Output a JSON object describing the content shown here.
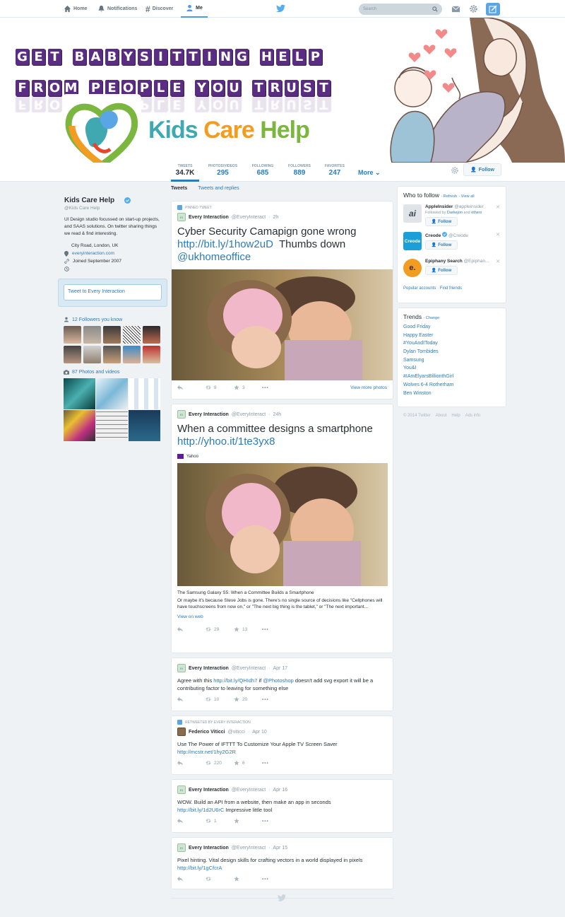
{
  "nav": {
    "home": "Home",
    "notifications": "Notifications",
    "discover": "Discover",
    "me": "Me",
    "search_placeholder": "Search"
  },
  "banner": {
    "line1": "GET BABYSITTING HELP",
    "line2": "FROM PEOPLE YOU TRUST",
    "brand_part1": "Kids ",
    "brand_part2": "Care ",
    "brand_part3": "Help"
  },
  "stats": [
    {
      "label": "TWEETS",
      "value": "34.7K"
    },
    {
      "label": "PHOTOS/VIDEOS",
      "value": "295"
    },
    {
      "label": "FOLLOWING",
      "value": "685"
    },
    {
      "label": "FOLLOWERS",
      "value": "889"
    },
    {
      "label": "FAVORITES",
      "value": "247"
    }
  ],
  "more_label": "More",
  "follow_label": "Follow",
  "profile": {
    "name": "Kids Care Help",
    "handle": "@Kids Care Help",
    "bio": "UI Design studio focussed on start-up projects, and SAAS solutions. On twitter sharing things we read & find interesting.",
    "location": "City Road, London, UK",
    "website": "everyinteraction.com",
    "joined": "Joined September 2007",
    "tweet_to": "Tweet to Every Interaction",
    "followers_known": "12 Followers you know",
    "photos_videos": "87 Photos and videos"
  },
  "tabs": {
    "tweets": "Tweets",
    "replies": "Tweets and replies"
  },
  "tweets": [
    {
      "context": "PINNED TWEET",
      "name": "Every Interaction",
      "screen": "@EveryInteract",
      "time": "2h",
      "text": "Cyber Security Camapign gone wrong",
      "link1": "http://bit.ly/1how2uD",
      "text2": "Thumbs down",
      "link2": "@ukhomeoffice",
      "retweets": "8",
      "favorites": "3",
      "view_more": "View more photos"
    },
    {
      "name": "Every Interaction",
      "screen": "@EveryInteract",
      "time": "24h",
      "text": "When a committee designs a smartphone",
      "link1": "http://yhoo.it/1te3yx8",
      "source": "Yahoo",
      "card_title": "The Samsung Galaxy S5: When a Committee Builds a Smartphone",
      "card_desc": "Or maybe it's because Steve Jobs is gone. There's no single source of decisions like \"Cellphones will have touchscreens from now on,\" or \"The next big thing is the tablet,\" or \"The next important...",
      "view_web": "View on web",
      "retweets": "29",
      "favorites": "13"
    },
    {
      "name": "Every Interaction",
      "screen": "@EveryInteract",
      "time": "Apr 17",
      "text_a": "Agree with this ",
      "link1": "http://bit.ly/QHIdh7",
      "text_b": "  if ",
      "link2": "@Photoshop",
      "text_c": " doesn't add svg export it will be a contributing factor to leaving for something else",
      "retweets": "10",
      "favorites": "20"
    },
    {
      "context": "RETWEETED BY EVERY INTERACTION",
      "name": "Federico Viticci",
      "screen": "@viticci",
      "time": "Apr 10",
      "text": "Use The Power of IFTTT To Customize Your Apple TV Screen Saver",
      "link1": "http://mcstr.net/1hy2G2R",
      "retweets": "220",
      "favorites": "6"
    },
    {
      "name": "Every Interaction",
      "screen": "@EveryInteract",
      "time": "Apr 16",
      "text": "WOW. Build an API from a website, then make an app in seconds",
      "link1": "http://bit.ly/1d2U6rC",
      "text2": "  Impressive little tool",
      "retweets": "1",
      "favorites": ""
    },
    {
      "name": "Every Interaction",
      "screen": "@EveryInteract",
      "time": "Apr 15",
      "text": "Pixel hinting. Vital design skills for crafting vectors in a world displayed in pixels ",
      "link1": "http://bit.ly/1gCfcrA",
      "retweets": "",
      "favorites": ""
    }
  ],
  "who_to_follow": {
    "title": "Who to follow",
    "refresh": "Refresh",
    "view_all": "View all",
    "accounts": [
      {
        "name": "AppleInsider",
        "screen": "@appleinsider",
        "sub_a": "Followed by ",
        "sub_b": "Darkejon",
        "sub_c": " and ",
        "sub_d": "others",
        "icon_text": "ai"
      },
      {
        "name": "Creode",
        "screen": "@Creode",
        "icon_text": "Creode"
      },
      {
        "name": "Epiphany Search",
        "screen": "@Epiphan...",
        "icon_text": "e."
      }
    ],
    "popular": "Popular accounts",
    "find_friends": "Find friends"
  },
  "trends": {
    "title": "Trends",
    "change": "Change",
    "items": [
      "Good Friday",
      "Happy Easter",
      "#YouAndIToday",
      "Dylan Tombides",
      "Samsung",
      "You&I",
      "#IAmElyarsBillionthGirl",
      "Wolves 6-4 Rotherham",
      "Ben Winston"
    ]
  },
  "footer": [
    "© 2014 Twitter",
    "About",
    "Help",
    "Ads info"
  ],
  "colors": {
    "accent": "#2b7bb9",
    "promo_tile": "#5a2d82",
    "brand_teal": "#3fa8b0",
    "brand_orange": "#f39c22",
    "brand_green": "#7bb63f"
  }
}
